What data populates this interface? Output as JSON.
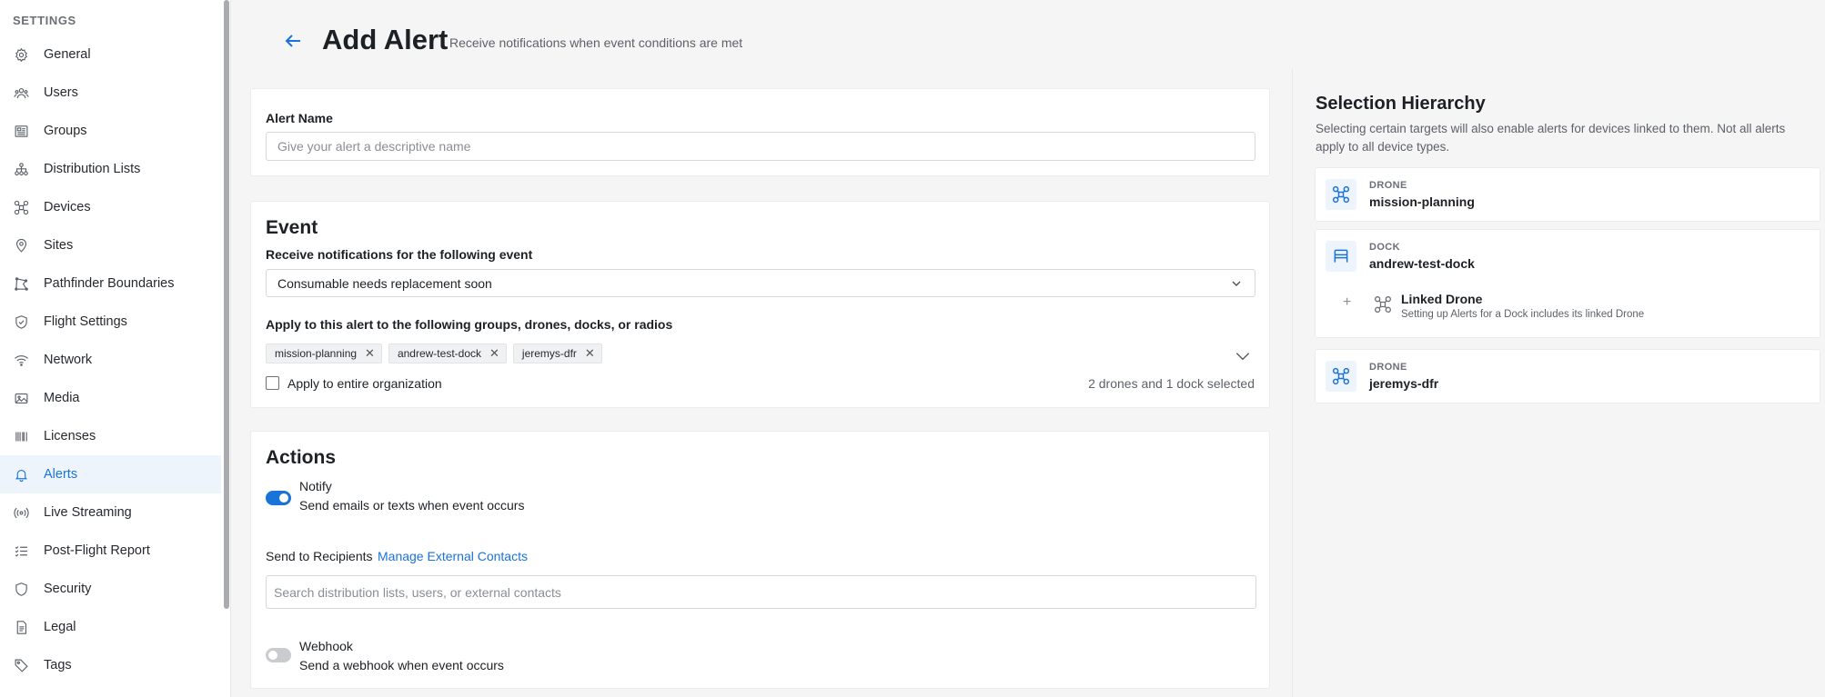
{
  "sidebar": {
    "title": "SETTINGS",
    "items": [
      {
        "label": "General",
        "icon": "gear-icon",
        "active": false
      },
      {
        "label": "Users",
        "icon": "users-icon",
        "active": false
      },
      {
        "label": "Groups",
        "icon": "groups-icon",
        "active": false
      },
      {
        "label": "Distribution Lists",
        "icon": "distribution-icon",
        "active": false
      },
      {
        "label": "Devices",
        "icon": "drone-icon",
        "active": false
      },
      {
        "label": "Sites",
        "icon": "pin-icon",
        "active": false
      },
      {
        "label": "Pathfinder Boundaries",
        "icon": "boundary-icon",
        "active": false
      },
      {
        "label": "Flight Settings",
        "icon": "shield-check-icon",
        "active": false
      },
      {
        "label": "Network",
        "icon": "wifi-icon",
        "active": false
      },
      {
        "label": "Media",
        "icon": "image-icon",
        "active": false
      },
      {
        "label": "Licenses",
        "icon": "barcode-icon",
        "active": false
      },
      {
        "label": "Alerts",
        "icon": "bell-icon",
        "active": true
      },
      {
        "label": "Live Streaming",
        "icon": "broadcast-icon",
        "active": false
      },
      {
        "label": "Post-Flight Report",
        "icon": "checklist-icon",
        "active": false
      },
      {
        "label": "Security",
        "icon": "shield-icon",
        "active": false
      },
      {
        "label": "Legal",
        "icon": "document-icon",
        "active": false
      },
      {
        "label": "Tags",
        "icon": "tag-icon",
        "active": false
      }
    ]
  },
  "header": {
    "title": "Add Alert",
    "subtitle": "Receive notifications when event conditions are met"
  },
  "alert_name": {
    "label": "Alert Name",
    "placeholder": "Give your alert a descriptive name",
    "value": ""
  },
  "event": {
    "title": "Event",
    "event_label": "Receive notifications for the following event",
    "event_value": "Consumable needs replacement soon",
    "apply_label": "Apply to this alert to the following groups, drones, docks, or radios",
    "chips": [
      "mission-planning",
      "andrew-test-dock",
      "jeremys-dfr"
    ],
    "org_checkbox_label": "Apply to entire organization",
    "org_checked": false,
    "selection_summary": "2 drones and 1 dock selected"
  },
  "actions": {
    "title": "Actions",
    "notify_title": "Notify",
    "notify_desc": "Send emails or texts when event occurs",
    "notify_on": true,
    "recipients_label": "Send to Recipients",
    "manage_link": "Manage External Contacts",
    "search_placeholder": "Search distribution lists, users, or external contacts",
    "webhook_title": "Webhook",
    "webhook_desc": "Send a webhook when event occurs",
    "webhook_on": false
  },
  "hierarchy": {
    "title": "Selection Hierarchy",
    "description": "Selecting certain targets will also enable alerts for devices linked to them. Not all alerts apply to all device types.",
    "items": [
      {
        "type": "DRONE",
        "name": "mission-planning",
        "icon": "drone-icon"
      },
      {
        "type": "DOCK",
        "name": "andrew-test-dock",
        "icon": "dock-icon",
        "linked": {
          "title": "Linked Drone",
          "desc": "Setting up Alerts for a Dock includes its linked Drone",
          "icon": "drone-icon"
        }
      },
      {
        "type": "DRONE",
        "name": "jeremys-dfr",
        "icon": "drone-icon"
      }
    ]
  },
  "colors": {
    "accent": "#1a73d9",
    "active_bg": "#eef4fc",
    "page_bg": "#f5f5f6"
  }
}
